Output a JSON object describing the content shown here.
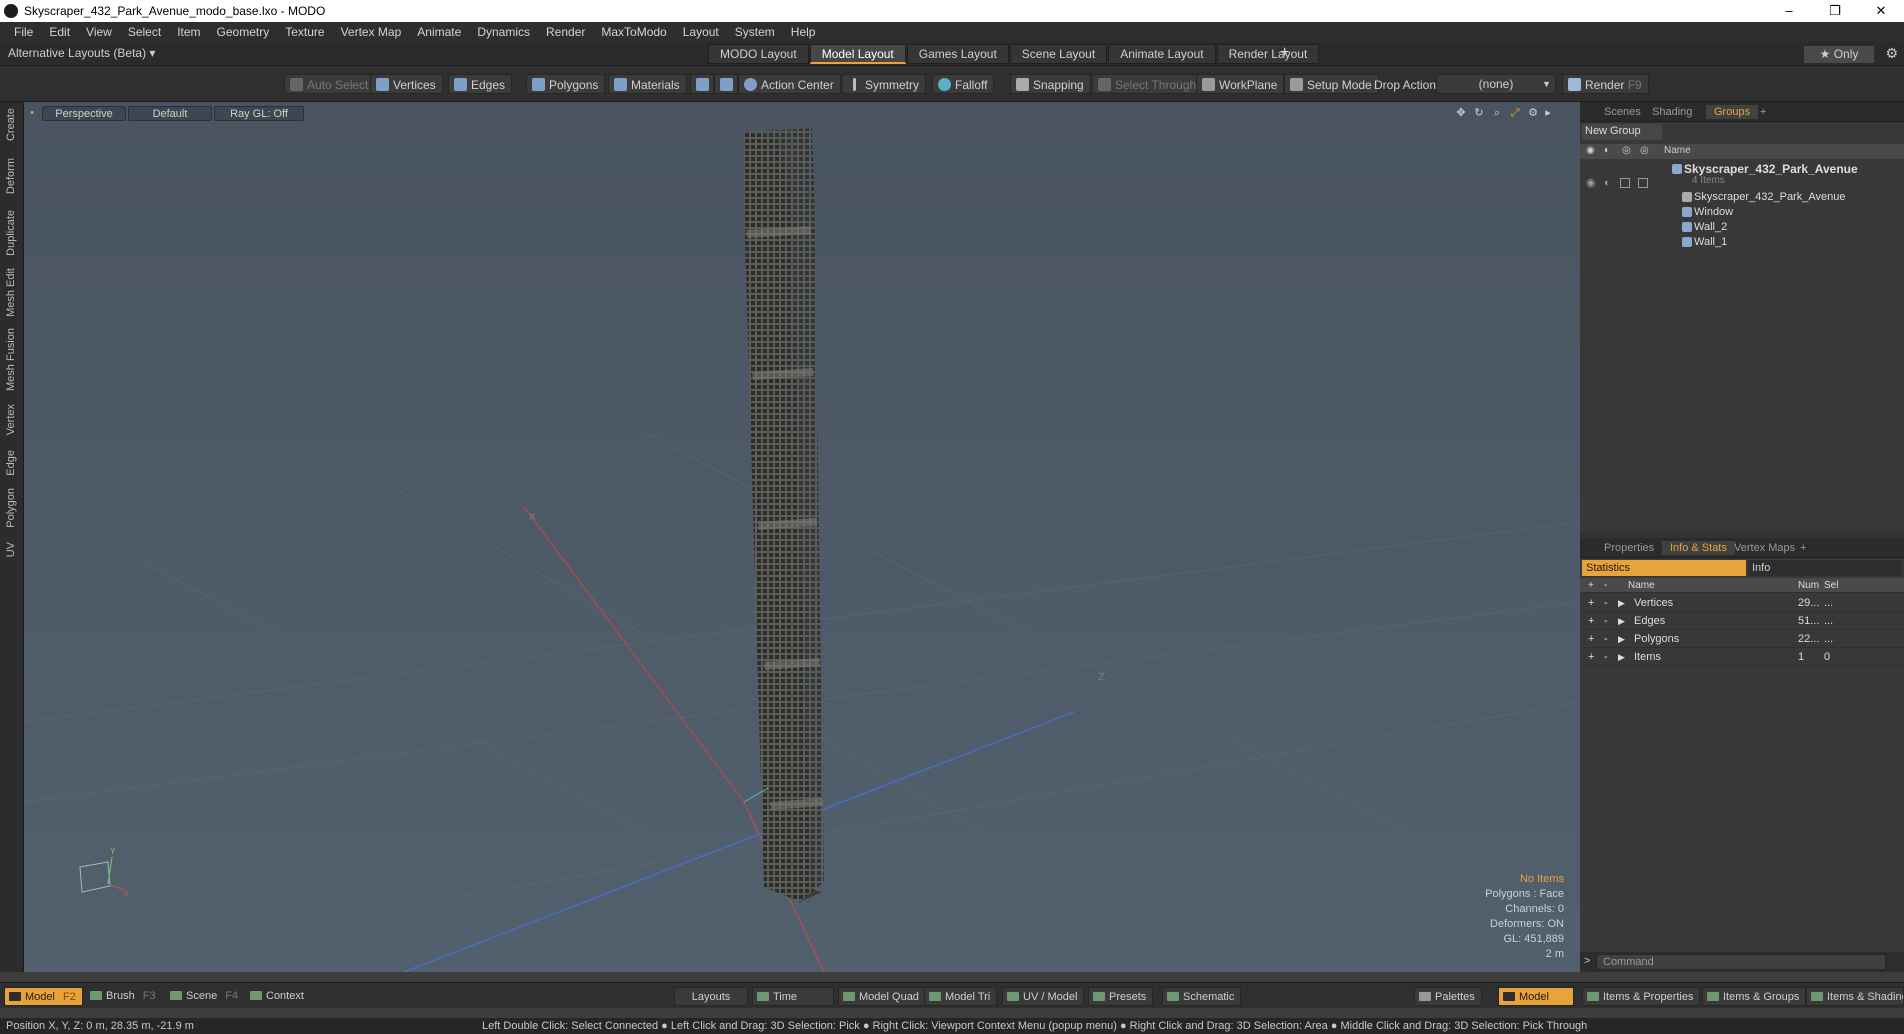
{
  "window": {
    "title": "Skyscraper_432_Park_Avenue_modo_base.lxo - MODO",
    "min": "–",
    "max": "❐",
    "close": "✕"
  },
  "menu": [
    "File",
    "Edit",
    "View",
    "Select",
    "Item",
    "Geometry",
    "Texture",
    "Vertex Map",
    "Animate",
    "Dynamics",
    "Render",
    "MaxToModo",
    "Layout",
    "System",
    "Help"
  ],
  "layout_bar": {
    "alt_layouts": "Alternative Layouts (Beta) ▾",
    "tabs": [
      "MODO Layout",
      "Model Layout",
      "Games Layout",
      "Scene Layout",
      "Animate Layout",
      "Render Layout"
    ],
    "active_tab": 1,
    "add": "+",
    "only": "★ Only"
  },
  "toolbar": {
    "auto_select": "Auto Select",
    "vertices": "Vertices",
    "edges": "Edges",
    "polygons": "Polygons",
    "materials": "Materials",
    "action_center": "Action Center",
    "symmetry": "Symmetry",
    "falloff": "Falloff",
    "snapping": "Snapping",
    "select_through": "Select Through",
    "workplane": "WorkPlane",
    "setup_mode": "Setup Mode",
    "drop_action": "Drop Action",
    "drop_value": "(none)",
    "render": "Render",
    "render_key": "F9"
  },
  "left_tabs": [
    "Create",
    "Deform",
    "Duplicate",
    "Mesh Edit",
    "Mesh Fusion",
    "Vertex",
    "Edge",
    "Polygon",
    "UV"
  ],
  "viewport": {
    "view": "Perspective",
    "shading": "Default",
    "raygl": "Ray GL: Off",
    "axis_x_label": "X",
    "axis_z_label": "Z",
    "gizmo_y": "Y",
    "gizmo_x": "X",
    "info": {
      "no_items": "No Items",
      "polygons": "Polygons : Face",
      "channels": "Channels: 0",
      "deformers": "Deformers: ON",
      "gl": "GL: 451,889",
      "scale": "2 m"
    }
  },
  "groups_panel": {
    "tabs": [
      "Scenes",
      "Shading",
      "Groups"
    ],
    "active_tab": 2,
    "add": "+",
    "new_group": "New Group",
    "col_name": "Name",
    "root": {
      "name": "Skyscraper_432_Park_Avenue",
      "count": "4 Items"
    },
    "children": [
      "Skyscraper_432_Park_Avenue",
      "Window",
      "Wall_2",
      "Wall_1"
    ]
  },
  "info_panel": {
    "tabs": [
      "Properties",
      "Info & Stats",
      "Vertex Maps"
    ],
    "active_tab": 1,
    "add": "+",
    "sub_tabs": [
      "Statistics",
      "Info"
    ],
    "columns": {
      "name": "Name",
      "num": "Num",
      "sel": "Sel"
    },
    "rows": [
      {
        "name": "Vertices",
        "num": "29...",
        "sel": "..."
      },
      {
        "name": "Edges",
        "num": "51...",
        "sel": "..."
      },
      {
        "name": "Polygons",
        "num": "22...",
        "sel": "..."
      },
      {
        "name": "Items",
        "num": "1",
        "sel": "0"
      }
    ]
  },
  "command": {
    "placeholder": "Command",
    "prompt": ">"
  },
  "bottom_bar": {
    "model": "Model",
    "model_key": "F2",
    "brush": "Brush",
    "brush_key": "F3",
    "scene": "Scene",
    "scene_key": "F4",
    "context": "Context",
    "layouts": "Layouts",
    "time": "Time",
    "model_quad": "Model Quad",
    "model_tri": "Model Tri",
    "uv_model": "UV / Model",
    "presets": "Presets",
    "schematic": "Schematic",
    "palettes": "Palettes",
    "model_right": "Model",
    "items_properties": "Items & Properties",
    "items_groups": "Items & Groups",
    "items_shading": "Items & Shading"
  },
  "status": {
    "position": "Position X, Y, Z:   0 m, 28.35 m, -21.9 m",
    "hints": "Left Double Click: Select Connected ● Left Click and Drag: 3D Selection: Pick ● Right Click: Viewport Context Menu (popup menu) ● Right Click and Drag: 3D Selection: Area ● Middle Click and Drag: 3D Selection: Pick Through"
  },
  "colors": {
    "accent": "#e8a33b",
    "viewport_bg": "#4d5966",
    "panel_bg": "#383838"
  }
}
